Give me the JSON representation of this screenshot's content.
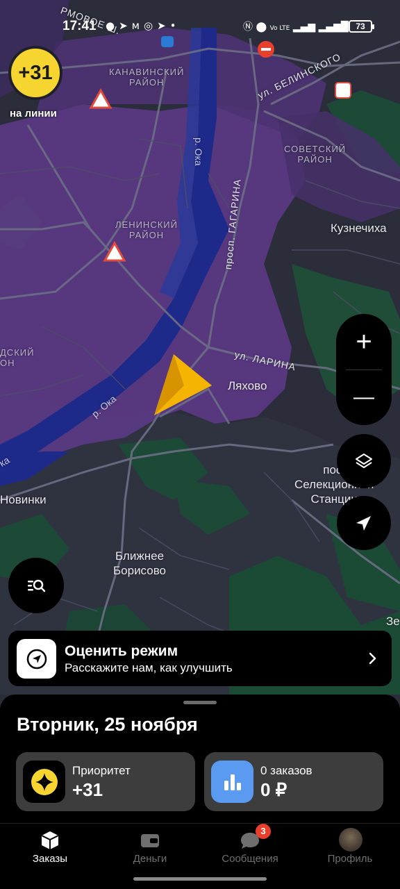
{
  "status_bar": {
    "time": "17:41",
    "left_icons": [
      "message-icon",
      "telegram-icon",
      "metro-icon",
      "instagram-icon",
      "telegram-icon",
      "dot-icon"
    ],
    "right_icons": [
      "nfc-icon",
      "location-icon",
      "volte-icon",
      "signal-4g-icon",
      "signal-icon"
    ],
    "network_label": "Vo LTE",
    "battery": "73"
  },
  "map": {
    "priority_badge": "+31",
    "online_label": "на линии",
    "districts": {
      "kanavinsky": "КАНАВИНСКИЙ\nРАЙОН",
      "sovetsky": "СОВЕТСКИЙ\nРАЙОН",
      "leninsky": "ЛЕНИНСКИЙ\nРАЙОН",
      "partial_left": "ДСКИЙ\nОН"
    },
    "places": {
      "kuznechikha": "Кузнечиха",
      "lyakhovo": "Ляхово",
      "selektsionnaya": "пос.\nСелекционной\nСтанции",
      "novinki": "Новинки",
      "borisovo": "Ближнее\nБорисово",
      "ze": "Зе"
    },
    "streets": {
      "belinskogo": "ул. БЕЛИНСКОГО",
      "gagarina": "просп. ГАГАРИНА",
      "larina": "ул. ЛАРИНА",
      "partial_top": "РМОВОЕ Ш."
    },
    "rivers": {
      "oka_1": "р. Ока",
      "oka_2": "р. Ока",
      "oka_3": "ка"
    },
    "zoom_in": "+",
    "zoom_out": "—"
  },
  "rate_banner": {
    "title": "Оценить режим",
    "subtitle": "Расскажите нам, как улучшить"
  },
  "sheet": {
    "date": "Вторник, 25 ноября",
    "cards": [
      {
        "label": "Приоритет",
        "value": "+31",
        "icon": "priority-star-icon"
      },
      {
        "label": "0 заказов",
        "value": "0 ₽",
        "icon": "bar-chart-icon"
      }
    ]
  },
  "tabs": [
    {
      "label": "Заказы",
      "icon": "box-icon",
      "active": true
    },
    {
      "label": "Деньги",
      "icon": "wallet-icon",
      "active": false
    },
    {
      "label": "Сообщения",
      "icon": "chat-icon",
      "active": false,
      "badge": "3"
    },
    {
      "label": "Профиль",
      "icon": "avatar",
      "active": false
    }
  ],
  "colors": {
    "map_bg": "#2b2e3a",
    "surge_purple": "#5b3a86",
    "river": "#1e2a8a",
    "green": "#1b4a35",
    "priority_yellow": "#f7d531",
    "arrow_yellow": "#f5b400",
    "badge_red": "#e8402c",
    "orders_blue": "#5a9af0"
  }
}
